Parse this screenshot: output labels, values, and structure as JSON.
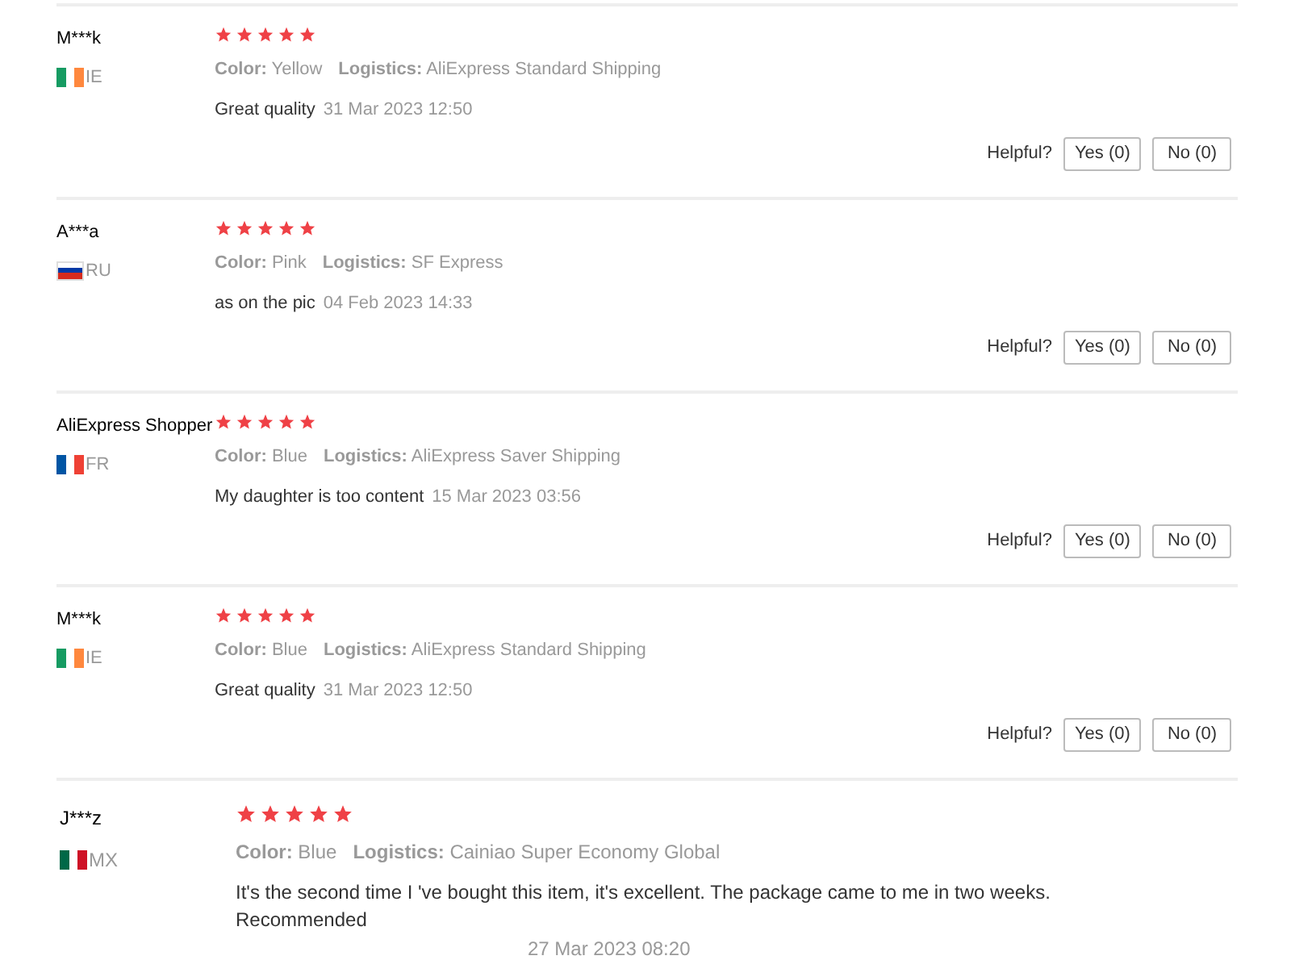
{
  "reviews": [
    {
      "name": "M***k",
      "country": "IE",
      "flag": {
        "kind": "vertical",
        "stripes": [
          {
            "color": "#169b62"
          },
          {
            "color": "#ffffff"
          },
          {
            "color": "#ff883e"
          }
        ]
      },
      "stars": 5,
      "color_label": "Color:",
      "product_color": "Yellow",
      "logistics_label": "Logistics:",
      "logistics": "AliExpress Standard Shipping",
      "comment": "Great quality",
      "date": "31 Mar 2023 12:50",
      "helpful": {
        "label": "Helpful?",
        "yes": "Yes (0)",
        "no": "No (0)"
      }
    },
    {
      "name": "A***a",
      "country": "RU",
      "flag": {
        "kind": "horizontal",
        "stripes": [
          {
            "color": "#ffffff"
          },
          {
            "color": "#0039a6"
          },
          {
            "color": "#d52b1e"
          }
        ]
      },
      "stars": 5,
      "color_label": "Color:",
      "product_color": "Pink",
      "logistics_label": "Logistics:",
      "logistics": "SF Express",
      "comment": "as on the pic",
      "date": "04 Feb 2023 14:33",
      "helpful": {
        "label": "Helpful?",
        "yes": "Yes (0)",
        "no": "No (0)"
      }
    },
    {
      "name": "AliExpress Shopper",
      "country": "FR",
      "flag": {
        "kind": "vertical",
        "stripes": [
          {
            "color": "#0055a4"
          },
          {
            "color": "#ffffff"
          },
          {
            "color": "#ef4135"
          }
        ]
      },
      "stars": 5,
      "color_label": "Color:",
      "product_color": "Blue",
      "logistics_label": "Logistics:",
      "logistics": "AliExpress Saver Shipping",
      "comment": "My daughter is too content",
      "date": "15 Mar 2023 03:56",
      "helpful": {
        "label": "Helpful?",
        "yes": "Yes (0)",
        "no": "No (0)"
      }
    },
    {
      "name": "M***k",
      "country": "IE",
      "flag": {
        "kind": "vertical",
        "stripes": [
          {
            "color": "#169b62"
          },
          {
            "color": "#ffffff"
          },
          {
            "color": "#ff883e"
          }
        ]
      },
      "stars": 5,
      "color_label": "Color:",
      "product_color": "Blue",
      "logistics_label": "Logistics:",
      "logistics": "AliExpress Standard Shipping",
      "comment": "Great quality",
      "date": "31 Mar 2023 12:50",
      "helpful": {
        "label": "Helpful?",
        "yes": "Yes (0)",
        "no": "No (0)"
      }
    },
    {
      "name": "J***z",
      "country": "MX",
      "flag": {
        "kind": "vertical",
        "stripes": [
          {
            "color": "#006847"
          },
          {
            "color": "#ffffff"
          },
          {
            "color": "#ce1126"
          }
        ]
      },
      "stars": 5,
      "color_label": "Color:",
      "product_color": "Blue",
      "logistics_label": "Logistics:",
      "logistics": "Cainiao Super Economy Global",
      "comment": "It's the second time I 've bought this item, it's excellent. The package came to me in two weeks. Recommended",
      "date": "27 Mar 2023 08:20",
      "large": true
    }
  ]
}
